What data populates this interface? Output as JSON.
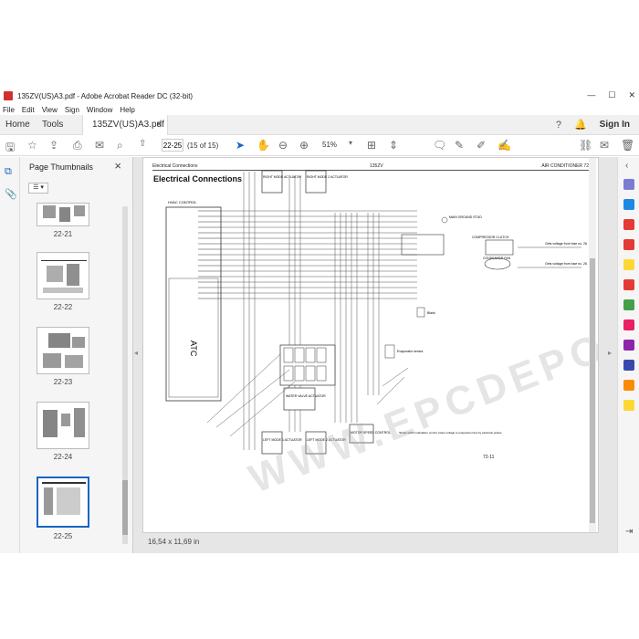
{
  "window": {
    "title": "135ZV(US)A3.pdf - Adobe Acrobat Reader DC (32-bit)",
    "min": "—",
    "max": "☐",
    "close": "✕"
  },
  "menu": [
    "File",
    "Edit",
    "View",
    "Sign",
    "Window",
    "Help"
  ],
  "tabs": {
    "home": "Home",
    "tools": "Tools",
    "doc": "135ZV(US)A3.pdf",
    "doc_close": "×",
    "signin": "Sign In"
  },
  "toolbar": {
    "page_current": "22-25",
    "page_count": "(15 of 15)",
    "zoom": "51%"
  },
  "thumbnails": {
    "header": "Page Thumbnails",
    "close": "×",
    "items": [
      {
        "label": "22-21"
      },
      {
        "label": "22-22"
      },
      {
        "label": "22-23"
      },
      {
        "label": "22-24"
      },
      {
        "label": "22-25"
      }
    ]
  },
  "document": {
    "header_left": "Electrical Connections",
    "header_center": "135ZV",
    "header_right": "AIR CONDITIONER 72",
    "title": "Electrical Connections",
    "page_number": "72-11",
    "size_info": "16,54 x 11,69 in",
    "watermark": "WWW.EPCDEPO.COM",
    "labels": {
      "hvac_control": "HVAC CONTROL",
      "atc": "ATC",
      "right_mode": "RIGHT MODE ACTUATOR",
      "right_temp": "RIGHT MODE 2 ACTUATOR",
      "left_mode": "LEFT MODE 1 ACTUATOR",
      "left_temp": "LEFT MODE 2 ACTUATOR",
      "water_valve": "WATER VALVE ACTUATOR",
      "motor_speed": "MOTOR SPEED CONTROL",
      "compressor": "COMPRESSOR CLUTCH",
      "condenser": "CONDENSER FAN",
      "main_ground": "MAIN GROUND STUD",
      "evaporator": "Evaporator sensor",
      "blank": "Blank",
      "fuse1": "Gets voltage from fuse no. 26",
      "fuse2": "Gets voltage from fuse no. 26",
      "note": "*Pulse width modulation control varies voltage to evaporator fans by electrical pulses."
    }
  },
  "colors": {
    "accent": "#1565c0",
    "adobe_red": "#d32f2f"
  }
}
